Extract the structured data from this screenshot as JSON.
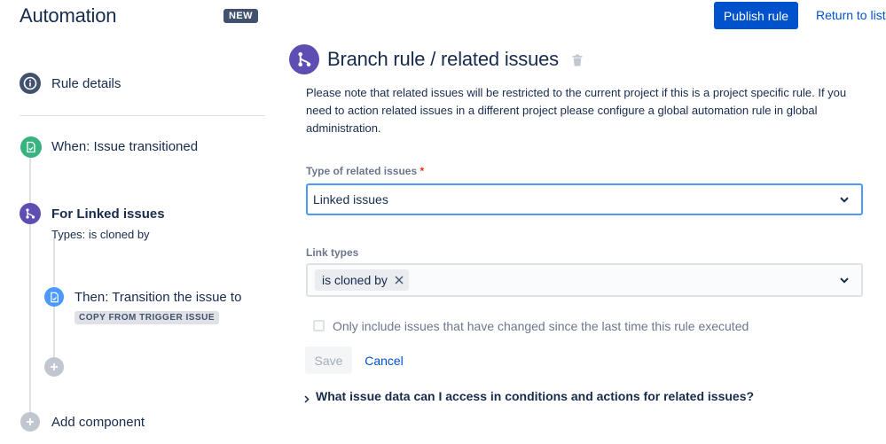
{
  "header": {
    "title": "Automation",
    "badge": "NEW",
    "publish_label": "Publish rule",
    "return_label": "Return to list"
  },
  "sidebar": {
    "rule_details": "Rule details",
    "trigger": "When: Issue transitioned",
    "branch": {
      "title": "For Linked issues",
      "subtitle": "Types: is cloned by"
    },
    "action": {
      "title": "Then: Transition the issue to",
      "lozenge": "COPY FROM TRIGGER ISSUE"
    },
    "add_component": "Add component"
  },
  "panel": {
    "title": "Branch rule / related issues",
    "note": "Please note that related issues will be restricted to the current project if this is a project specific rule. If you need to action related issues in a different project please configure a global automation rule in global administration.",
    "type_label": "Type of related issues",
    "required_mark": "*",
    "type_value": "Linked issues",
    "link_types_label": "Link types",
    "link_type_tags": [
      "is cloned by"
    ],
    "checkbox_label": "Only include issues that have changed since the last time this rule executed",
    "checkbox_checked": false,
    "save_label": "Save",
    "cancel_label": "Cancel",
    "faq_label": "What issue data can I access in conditions and actions for related issues?"
  },
  "colors": {
    "primary": "#0052cc",
    "branch": "#5e4db2",
    "trigger": "#36b37e",
    "action": "#4c9aff",
    "neutral_icon": "#42526e",
    "text": "#172b4d",
    "subtle_text": "#6b778c"
  },
  "icons": {
    "rule_details": "info-icon",
    "trigger": "trigger-icon",
    "branch": "branch-icon",
    "action": "action-icon",
    "add": "plus-icon",
    "delete": "trash-icon",
    "dropdown": "chevron-down-icon",
    "remove_tag": "close-icon",
    "expand": "chevron-right-icon"
  }
}
